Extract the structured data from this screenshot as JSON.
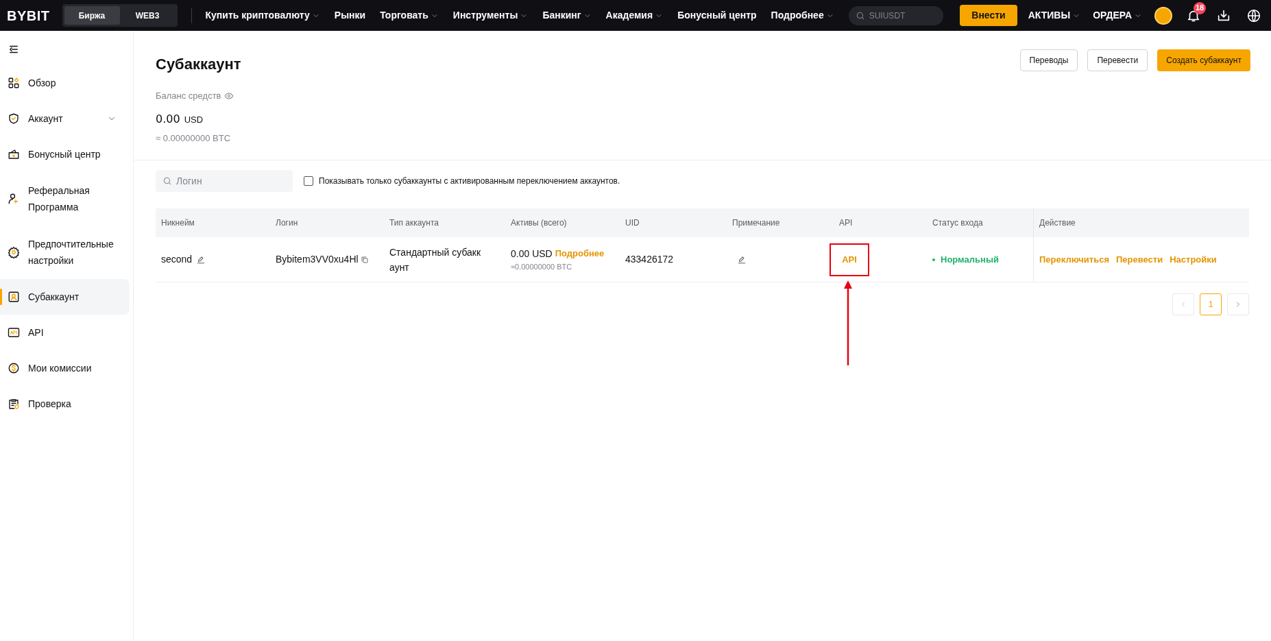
{
  "topbar": {
    "logo": "BYBIT",
    "segments": [
      {
        "label": "Биржа",
        "selected": true
      },
      {
        "label": "WEB3",
        "selected": false
      }
    ],
    "nav": [
      {
        "label": "Купить криптовалюту",
        "dropdown": true
      },
      {
        "label": "Рынки",
        "dropdown": false
      },
      {
        "label": "Торговать",
        "dropdown": true
      },
      {
        "label": "Инструменты",
        "dropdown": true
      },
      {
        "label": "Банкинг",
        "dropdown": true
      },
      {
        "label": "Академия",
        "dropdown": true
      },
      {
        "label": "Бонусный центр",
        "dropdown": false
      },
      {
        "label": "Подробнее",
        "dropdown": true
      }
    ],
    "search": {
      "placeholder": "SUIUSDT"
    },
    "deposit_button": "Внести",
    "menus": [
      "АКТИВЫ",
      "ОРДЕРА"
    ],
    "notification_count": "18"
  },
  "sidebar": {
    "items": [
      {
        "label": "Обзор",
        "kind": "overview",
        "selected": false,
        "expandable": false
      },
      {
        "label": "Аккаунт",
        "kind": "shield",
        "selected": false,
        "expandable": true
      },
      {
        "label": "Бонусный центр",
        "kind": "gift",
        "selected": false,
        "expandable": false
      },
      {
        "label": "Реферальная Программа",
        "kind": "referral",
        "selected": false,
        "expandable": false
      },
      {
        "label": "Предпочтительные настройки",
        "kind": "gear",
        "selected": false,
        "expandable": false
      },
      {
        "label": "Субаккаунт",
        "kind": "person",
        "selected": true,
        "expandable": false
      },
      {
        "label": "API",
        "kind": "api",
        "selected": false,
        "expandable": false
      },
      {
        "label": "Мои комиссии",
        "kind": "coin",
        "selected": false,
        "expandable": false
      },
      {
        "label": "Проверка",
        "kind": "clipboard",
        "selected": false,
        "expandable": false
      }
    ]
  },
  "page": {
    "title": "Субаккаунт",
    "buttons": [
      {
        "label": "Переводы",
        "primary": false
      },
      {
        "label": "Перевести",
        "primary": false
      },
      {
        "label": "Создать субаккаунт",
        "primary": true
      }
    ],
    "balance": {
      "label": "Баланс средств",
      "amount": "0.00",
      "currency": "USD",
      "btc": "≈ 0.00000000 BTC"
    }
  },
  "filter": {
    "search_placeholder": "Логин",
    "checkbox": {
      "label": "Показывать только субаккаунты с активированным переключением аккаунтов.",
      "checked": false
    }
  },
  "table": {
    "columns": [
      "Никнейм",
      "Логин",
      "Тип аккаунта",
      "Активы (всего)",
      "UID",
      "Примечание",
      "API",
      "Статус входа",
      "Действие"
    ],
    "rows": [
      {
        "nickname": "second",
        "login": "Bybitem3VV0xu4Hl",
        "type": "Стандартный субаккаунт",
        "assets": "0.00 USD",
        "assets_link": "Подробнее",
        "assets_btc": "≈0.00000000 BTC",
        "uid": "433426172",
        "api": "API",
        "status": "Нормальный",
        "actions": [
          "Переключиться",
          "Перевести",
          "Настройки"
        ]
      }
    ]
  },
  "pagination": {
    "pages": [
      {
        "label": "1",
        "selected": true
      }
    ]
  }
}
